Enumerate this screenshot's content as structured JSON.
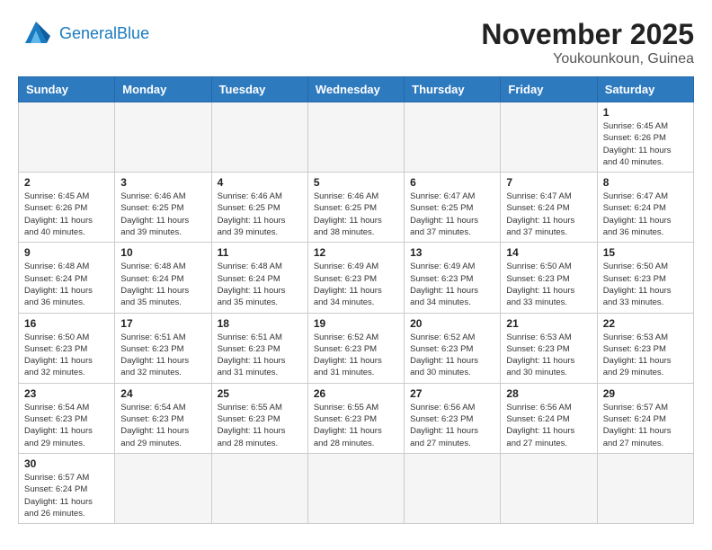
{
  "header": {
    "logo_general": "General",
    "logo_blue": "Blue",
    "month": "November 2025",
    "location": "Youkounkoun, Guinea"
  },
  "weekdays": [
    "Sunday",
    "Monday",
    "Tuesday",
    "Wednesday",
    "Thursday",
    "Friday",
    "Saturday"
  ],
  "weeks": [
    [
      {
        "day": "",
        "content": ""
      },
      {
        "day": "",
        "content": ""
      },
      {
        "day": "",
        "content": ""
      },
      {
        "day": "",
        "content": ""
      },
      {
        "day": "",
        "content": ""
      },
      {
        "day": "",
        "content": ""
      },
      {
        "day": "1",
        "content": "Sunrise: 6:45 AM\nSunset: 6:26 PM\nDaylight: 11 hours\nand 40 minutes."
      }
    ],
    [
      {
        "day": "2",
        "content": "Sunrise: 6:45 AM\nSunset: 6:26 PM\nDaylight: 11 hours\nand 40 minutes."
      },
      {
        "day": "3",
        "content": "Sunrise: 6:46 AM\nSunset: 6:25 PM\nDaylight: 11 hours\nand 39 minutes."
      },
      {
        "day": "4",
        "content": "Sunrise: 6:46 AM\nSunset: 6:25 PM\nDaylight: 11 hours\nand 39 minutes."
      },
      {
        "day": "5",
        "content": "Sunrise: 6:46 AM\nSunset: 6:25 PM\nDaylight: 11 hours\nand 38 minutes."
      },
      {
        "day": "6",
        "content": "Sunrise: 6:47 AM\nSunset: 6:25 PM\nDaylight: 11 hours\nand 37 minutes."
      },
      {
        "day": "7",
        "content": "Sunrise: 6:47 AM\nSunset: 6:24 PM\nDaylight: 11 hours\nand 37 minutes."
      },
      {
        "day": "8",
        "content": "Sunrise: 6:47 AM\nSunset: 6:24 PM\nDaylight: 11 hours\nand 36 minutes."
      }
    ],
    [
      {
        "day": "9",
        "content": "Sunrise: 6:48 AM\nSunset: 6:24 PM\nDaylight: 11 hours\nand 36 minutes."
      },
      {
        "day": "10",
        "content": "Sunrise: 6:48 AM\nSunset: 6:24 PM\nDaylight: 11 hours\nand 35 minutes."
      },
      {
        "day": "11",
        "content": "Sunrise: 6:48 AM\nSunset: 6:24 PM\nDaylight: 11 hours\nand 35 minutes."
      },
      {
        "day": "12",
        "content": "Sunrise: 6:49 AM\nSunset: 6:23 PM\nDaylight: 11 hours\nand 34 minutes."
      },
      {
        "day": "13",
        "content": "Sunrise: 6:49 AM\nSunset: 6:23 PM\nDaylight: 11 hours\nand 34 minutes."
      },
      {
        "day": "14",
        "content": "Sunrise: 6:50 AM\nSunset: 6:23 PM\nDaylight: 11 hours\nand 33 minutes."
      },
      {
        "day": "15",
        "content": "Sunrise: 6:50 AM\nSunset: 6:23 PM\nDaylight: 11 hours\nand 33 minutes."
      }
    ],
    [
      {
        "day": "16",
        "content": "Sunrise: 6:50 AM\nSunset: 6:23 PM\nDaylight: 11 hours\nand 32 minutes."
      },
      {
        "day": "17",
        "content": "Sunrise: 6:51 AM\nSunset: 6:23 PM\nDaylight: 11 hours\nand 32 minutes."
      },
      {
        "day": "18",
        "content": "Sunrise: 6:51 AM\nSunset: 6:23 PM\nDaylight: 11 hours\nand 31 minutes."
      },
      {
        "day": "19",
        "content": "Sunrise: 6:52 AM\nSunset: 6:23 PM\nDaylight: 11 hours\nand 31 minutes."
      },
      {
        "day": "20",
        "content": "Sunrise: 6:52 AM\nSunset: 6:23 PM\nDaylight: 11 hours\nand 30 minutes."
      },
      {
        "day": "21",
        "content": "Sunrise: 6:53 AM\nSunset: 6:23 PM\nDaylight: 11 hours\nand 30 minutes."
      },
      {
        "day": "22",
        "content": "Sunrise: 6:53 AM\nSunset: 6:23 PM\nDaylight: 11 hours\nand 29 minutes."
      }
    ],
    [
      {
        "day": "23",
        "content": "Sunrise: 6:54 AM\nSunset: 6:23 PM\nDaylight: 11 hours\nand 29 minutes."
      },
      {
        "day": "24",
        "content": "Sunrise: 6:54 AM\nSunset: 6:23 PM\nDaylight: 11 hours\nand 29 minutes."
      },
      {
        "day": "25",
        "content": "Sunrise: 6:55 AM\nSunset: 6:23 PM\nDaylight: 11 hours\nand 28 minutes."
      },
      {
        "day": "26",
        "content": "Sunrise: 6:55 AM\nSunset: 6:23 PM\nDaylight: 11 hours\nand 28 minutes."
      },
      {
        "day": "27",
        "content": "Sunrise: 6:56 AM\nSunset: 6:23 PM\nDaylight: 11 hours\nand 27 minutes."
      },
      {
        "day": "28",
        "content": "Sunrise: 6:56 AM\nSunset: 6:24 PM\nDaylight: 11 hours\nand 27 minutes."
      },
      {
        "day": "29",
        "content": "Sunrise: 6:57 AM\nSunset: 6:24 PM\nDaylight: 11 hours\nand 27 minutes."
      }
    ],
    [
      {
        "day": "30",
        "content": "Sunrise: 6:57 AM\nSunset: 6:24 PM\nDaylight: 11 hours\nand 26 minutes."
      },
      {
        "day": "",
        "content": ""
      },
      {
        "day": "",
        "content": ""
      },
      {
        "day": "",
        "content": ""
      },
      {
        "day": "",
        "content": ""
      },
      {
        "day": "",
        "content": ""
      },
      {
        "day": "",
        "content": ""
      }
    ]
  ]
}
